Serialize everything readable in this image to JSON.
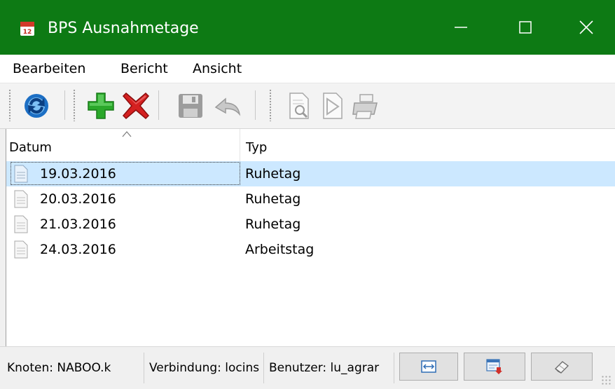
{
  "window": {
    "title": "BPS Ausnahmetage",
    "title_bar_color": "#0d7a14",
    "icons": {
      "app": "calendar-12-icon",
      "minimize": "minimize-icon",
      "maximize": "maximize-icon",
      "close": "close-icon"
    }
  },
  "menu": {
    "items": [
      {
        "label": "Bearbeiten"
      },
      {
        "label": "Bericht"
      },
      {
        "label": "Ansicht"
      }
    ]
  },
  "toolbar": {
    "buttons": [
      {
        "name": "refresh",
        "icon": "refresh-icon",
        "enabled": true
      },
      {
        "name": "add",
        "icon": "add-plus-icon",
        "enabled": true
      },
      {
        "name": "delete",
        "icon": "delete-x-icon",
        "enabled": true
      },
      {
        "name": "save",
        "icon": "save-disk-icon",
        "enabled": false
      },
      {
        "name": "undo",
        "icon": "undo-icon",
        "enabled": false
      },
      {
        "name": "preview",
        "icon": "print-preview-icon",
        "enabled": false
      },
      {
        "name": "export",
        "icon": "export-pdf-icon",
        "enabled": false
      },
      {
        "name": "print",
        "icon": "printer-icon",
        "enabled": false
      }
    ]
  },
  "list": {
    "columns": [
      {
        "label": "Datum",
        "sorted": "ascending"
      },
      {
        "label": "Typ"
      }
    ],
    "rows": [
      {
        "datum": "19.03.2016",
        "typ": "Ruhetag",
        "selected": true
      },
      {
        "datum": "20.03.2016",
        "typ": "Ruhetag",
        "selected": false
      },
      {
        "datum": "21.03.2016",
        "typ": "Ruhetag",
        "selected": false
      },
      {
        "datum": "24.03.2016",
        "typ": "Arbeitstag",
        "selected": false
      }
    ],
    "row_icon": "document-icon",
    "selection_color": "#cce8ff"
  },
  "statusbar": {
    "knoten": "Knoten: NABOO.k",
    "verbindung": "Verbindung: locins",
    "benutzer": "Benutzer: lu_agrar",
    "buttons": [
      {
        "icon": "fit-width-icon"
      },
      {
        "icon": "export-list-icon"
      },
      {
        "icon": "eraser-icon"
      }
    ]
  }
}
